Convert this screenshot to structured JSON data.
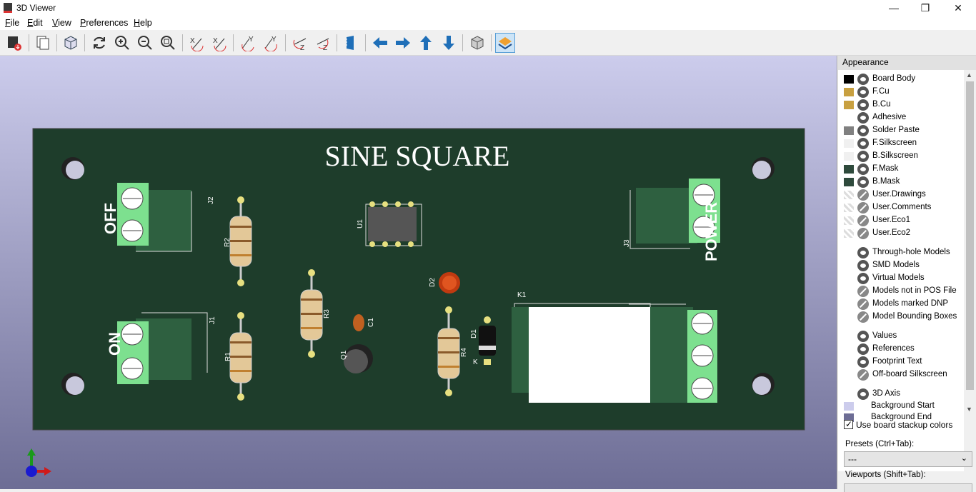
{
  "window": {
    "title": "3D Viewer",
    "minimize": "—",
    "maximize": "❐",
    "close": "✕"
  },
  "menu": [
    {
      "label": "File",
      "key": "F"
    },
    {
      "label": "Edit",
      "key": "E"
    },
    {
      "label": "View",
      "key": "V"
    },
    {
      "label": "Preferences",
      "key": "P"
    },
    {
      "label": "Help",
      "key": "H"
    }
  ],
  "toolbar": [
    "export-image",
    "copy-to-clipboard",
    "board-3d",
    "reload",
    "zoom-in",
    "zoom-out",
    "zoom-fit",
    "rotate-x-cw",
    "rotate-x-ccw",
    "rotate-y-cw",
    "rotate-y-ccw",
    "rotate-z-cw",
    "rotate-z-ccw",
    "flip-board",
    "pan-left",
    "pan-right",
    "pan-up",
    "pan-down",
    "orthographic",
    "layers-manager"
  ],
  "pcb": {
    "title": "SINE SQUARE",
    "refs": [
      "J2",
      "R2",
      "U1",
      "J3",
      "D2",
      "K1",
      "J1",
      "R3",
      "C1",
      "R1",
      "Q1",
      "R4",
      "D1",
      "K"
    ],
    "silk_off": "OFF",
    "silk_on": "ON",
    "silk_power": "POWER"
  },
  "appearance": {
    "header": "Appearance",
    "layers": [
      {
        "label": "Board Body",
        "color": "#000000",
        "visible": true
      },
      {
        "label": "F.Cu",
        "color": "#c8a040",
        "visible": true
      },
      {
        "label": "B.Cu",
        "color": "#c8a040",
        "visible": true
      },
      {
        "label": "Adhesive",
        "color": "",
        "visible": true
      },
      {
        "label": "Solder Paste",
        "color": "#808080",
        "visible": true
      },
      {
        "label": "F.Silkscreen",
        "color": "#f0f0f0",
        "visible": true
      },
      {
        "label": "B.Silkscreen",
        "color": "#f0f0f0",
        "visible": true
      },
      {
        "label": "F.Mask",
        "color": "#2e4a3c",
        "visible": true
      },
      {
        "label": "B.Mask",
        "color": "#2e4a3c",
        "visible": true
      },
      {
        "label": "User.Drawings",
        "color": "checker",
        "visible": false
      },
      {
        "label": "User.Comments",
        "color": "checker",
        "visible": false
      },
      {
        "label": "User.Eco1",
        "color": "checker",
        "visible": false
      },
      {
        "label": "User.Eco2",
        "color": "checker",
        "visible": false
      }
    ],
    "models": [
      {
        "label": "Through-hole Models",
        "visible": true
      },
      {
        "label": "SMD Models",
        "visible": true
      },
      {
        "label": "Virtual Models",
        "visible": true
      },
      {
        "label": "Models not in POS File",
        "visible": false
      },
      {
        "label": "Models marked DNP",
        "visible": false
      },
      {
        "label": "Model Bounding Boxes",
        "visible": false
      }
    ],
    "text": [
      {
        "label": "Values",
        "visible": true
      },
      {
        "label": "References",
        "visible": true
      },
      {
        "label": "Footprint Text",
        "visible": true
      },
      {
        "label": "Off-board Silkscreen",
        "visible": false
      }
    ],
    "axis": {
      "label": "3D Axis",
      "visible": true
    },
    "background_start": {
      "label": "Background Start",
      "color": "#ccccec"
    },
    "background_end": {
      "label": "Background End",
      "color": "#6d6d95"
    },
    "use_stackup": {
      "label": "Use board stackup colors",
      "checked": true
    },
    "presets_label": "Presets (Ctrl+Tab):",
    "presets_value": "---",
    "viewports_label": "Viewports (Shift+Tab):"
  }
}
